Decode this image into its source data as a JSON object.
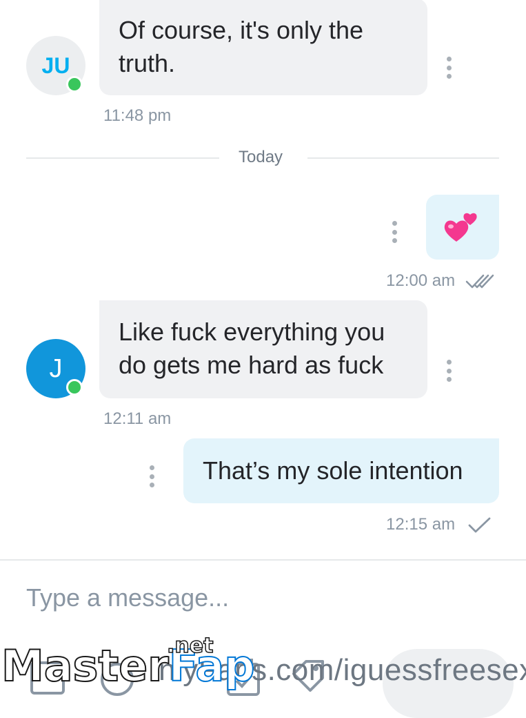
{
  "messages": [
    {
      "direction": "incoming",
      "avatar_initials": "JU",
      "text_line1": "Of course, it's only the",
      "text_line2": "truth.",
      "time": "11:48 pm"
    },
    {
      "direction": "outgoing",
      "emoji": "💕",
      "time": "12:00 am",
      "status": "read"
    },
    {
      "direction": "incoming",
      "avatar_initials": "J",
      "text_line1": "Like fuck everything you",
      "text_line2": "do gets me hard as fuck",
      "time": "12:11 am"
    },
    {
      "direction": "outgoing",
      "text_line1": "That’s my sole intention",
      "time": "12:15 am",
      "status": "sent"
    }
  ],
  "divider": {
    "label": "Today"
  },
  "composer": {
    "placeholder": "Type a message..."
  },
  "overlay": {
    "url_text": "nlyFans.com/iguessfreesex",
    "brand_part1": "Master",
    "brand_part2": "Fap",
    "brand_suffix": ".net"
  },
  "colors": {
    "accent": "#00aff0",
    "incoming_bubble": "#f0f1f3",
    "outgoing_bubble": "#e3f4fb",
    "online": "#39c65c",
    "meta_text": "#8a96a3"
  }
}
